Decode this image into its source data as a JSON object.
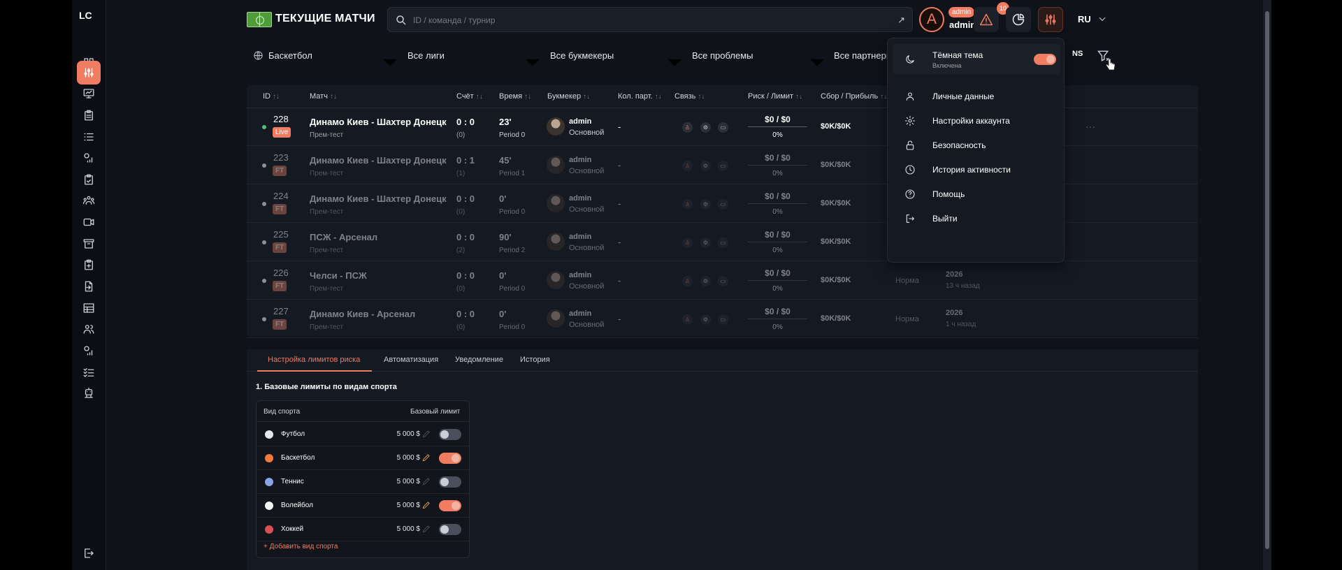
{
  "app": {
    "logo": "LC",
    "page_title": "ТЕКУЩИЕ МАТЧИ"
  },
  "search": {
    "placeholder": "ID / команда / турнир"
  },
  "user": {
    "avatar_letter": "A",
    "role": "admin",
    "name": "admin",
    "notifications": "10",
    "language": "RU"
  },
  "filters": {
    "sport": "Баскетбол",
    "leagues": "Все лиги",
    "bookmakers": "Все букмекеры",
    "problems": "Все проблемы",
    "partners": "Все партнеры",
    "ns": "NS"
  },
  "table": {
    "columns": [
      "ID",
      "Матч",
      "Счёт",
      "Время",
      "Букмекер",
      "Кол. парт.",
      "Связь",
      "Риск / Лимит",
      "Сбор / Прибыль"
    ],
    "rows": [
      {
        "id": "228",
        "badge": "Live",
        "match": "Динамо Киев - Шахтер Донецк",
        "tournament": "Прем-тест",
        "score": "0 : 0",
        "score_sub": "(0)",
        "time": "23'",
        "period": "Period 0",
        "bookmaker": "admin",
        "bk_type": "Основной",
        "partners": "-",
        "risk": "$0 / $0",
        "pct": "0%",
        "fee": "$0K/$0K",
        "status": "",
        "year": "",
        "ago": ""
      },
      {
        "id": "223",
        "badge": "FT",
        "match": "Динамо Киев - Шахтер Донецк",
        "tournament": "Прем-тест",
        "score": "0 : 1",
        "score_sub": "(1)",
        "time": "45'",
        "period": "Period 1",
        "bookmaker": "admin",
        "bk_type": "Основной",
        "partners": "-",
        "risk": "$0 / $0",
        "pct": "0%",
        "fee": "$0K/$0K",
        "status": "",
        "year": "",
        "ago": ""
      },
      {
        "id": "224",
        "badge": "FT",
        "match": "Динамо Киев - Шахтер Донецк",
        "tournament": "Прем-тест",
        "score": "0 : 0",
        "score_sub": "(0)",
        "time": "0'",
        "period": "Period 0",
        "bookmaker": "admin",
        "bk_type": "Основной",
        "partners": "-",
        "risk": "$0 / $0",
        "pct": "0%",
        "fee": "$0K/$0K",
        "status": "",
        "year": "",
        "ago": ""
      },
      {
        "id": "225",
        "badge": "FT",
        "match": "ПСЖ - Арсенал",
        "tournament": "Прем-тест",
        "score": "0 : 0",
        "score_sub": "(2)",
        "time": "90'",
        "period": "Period 2",
        "bookmaker": "admin",
        "bk_type": "Основной",
        "partners": "-",
        "risk": "$0 / $0",
        "pct": "0%",
        "fee": "$0K/$0K",
        "status": "",
        "year": "",
        "ago": ""
      },
      {
        "id": "226",
        "badge": "FT",
        "match": "Челси - ПСЖ",
        "tournament": "Прем-тест",
        "score": "0 : 0",
        "score_sub": "(0)",
        "time": "0'",
        "period": "Period 0",
        "bookmaker": "admin",
        "bk_type": "Основной",
        "partners": "-",
        "risk": "$0 / $0",
        "pct": "0%",
        "fee": "$0K/$0K",
        "status": "Норма",
        "year": "2026",
        "ago": "13 ч назад"
      },
      {
        "id": "227",
        "badge": "FT",
        "match": "Динамо Киев - Арсенал",
        "tournament": "Прем-тест",
        "score": "0 : 0",
        "score_sub": "(0)",
        "time": "0'",
        "period": "Period 0",
        "bookmaker": "admin",
        "bk_type": "Основной",
        "partners": "-",
        "risk": "$0 / $0",
        "pct": "0%",
        "fee": "$0K/$0K",
        "status": "Норма",
        "year": "2026",
        "ago": "1 ч назад"
      }
    ]
  },
  "tabs": [
    "Настройка лимитов риска",
    "Автоматизация",
    "Уведомление",
    "История"
  ],
  "limits": {
    "section_title": "1. Базовые лимиты по видам спорта",
    "col_sport": "Вид спорта",
    "col_limit": "Базовый лимит",
    "rows": [
      {
        "sport": "Футбол",
        "value": "5 000 $",
        "enabled": false,
        "icon_color": "#e6e8ee"
      },
      {
        "sport": "Баскетбол",
        "value": "5 000 $",
        "enabled": true,
        "icon_color": "#f07c3a"
      },
      {
        "sport": "Теннис",
        "value": "5 000 $",
        "enabled": false,
        "icon_color": "#8aa6e6"
      },
      {
        "sport": "Волейбол",
        "value": "5 000 $",
        "enabled": true,
        "icon_color": "#f2f2f2"
      },
      {
        "sport": "Хоккей",
        "value": "5 000 $",
        "enabled": false,
        "icon_color": "#d85050"
      }
    ],
    "add_label": "+ Добавить вид спорта"
  },
  "dropdown": {
    "theme_title": "Тёмная тема",
    "theme_status": "Включена",
    "items": [
      "Личные данные",
      "Настройки аккаунта",
      "Безопасность",
      "История активности",
      "Помощь",
      "Выйти"
    ]
  },
  "colors": {
    "accent": "#f07c62",
    "background": "#0f1218",
    "live": "#4fc27a"
  }
}
